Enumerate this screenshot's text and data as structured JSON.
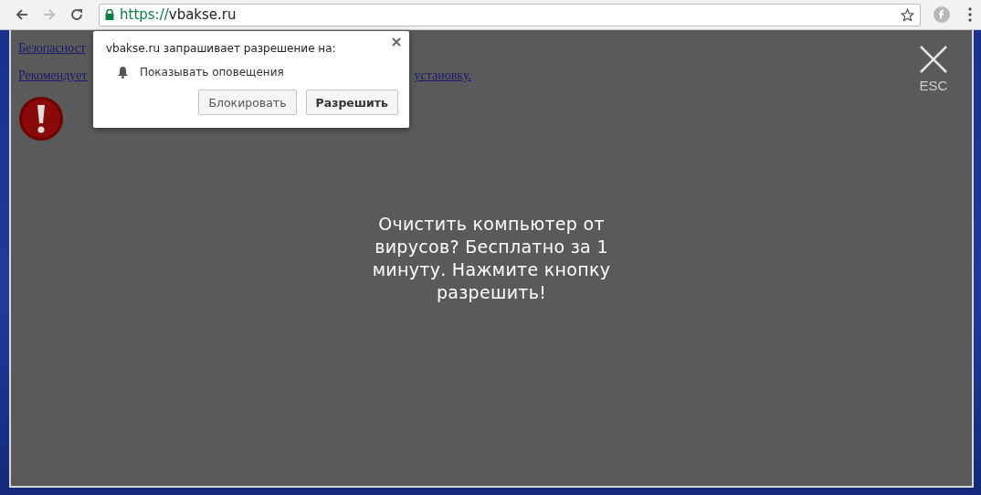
{
  "toolbar": {
    "forward_disabled": true,
    "url_scheme": "https://",
    "url_host": "vbakse.ru"
  },
  "page": {
    "link_first": "Безопасност",
    "link_second_start": "Рекомендует",
    "link_second_end": "установку."
  },
  "overlay": {
    "message": "Очистить компьютер от вирусов? Бесплатно за 1 минуту. Нажмите кнопку разрешить!",
    "close_label": "ESC"
  },
  "popup": {
    "title": "vbakse.ru запрашивает разрешение на:",
    "permission": "Показывать оповещения",
    "buttons": [
      {
        "label": "Блокировать",
        "kind": "secondary"
      },
      {
        "label": "Разрешить",
        "kind": "primary"
      }
    ]
  }
}
